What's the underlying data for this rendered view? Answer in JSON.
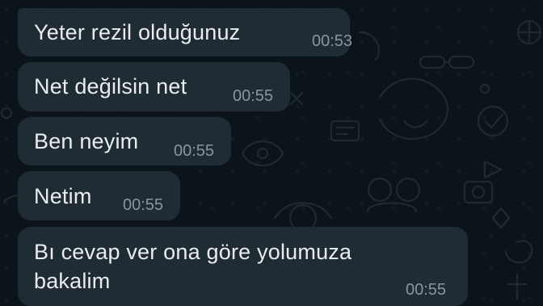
{
  "chat": {
    "messages": [
      {
        "text": "Yeter rezil olduğunuz",
        "time": "00:53"
      },
      {
        "text": "Net değilsin net",
        "time": "00:55"
      },
      {
        "text": "Ben neyim",
        "time": "00:55"
      },
      {
        "text": "Netim",
        "time": "00:55"
      },
      {
        "text_line1": "Bı cevap ver ona göre yolumuza",
        "text_line2": "bakalim",
        "time": "00:55"
      }
    ]
  },
  "colors": {
    "background": "#0b141a",
    "bubble": "#202c33",
    "text": "#e9edef",
    "timestamp": "#8696a0"
  }
}
